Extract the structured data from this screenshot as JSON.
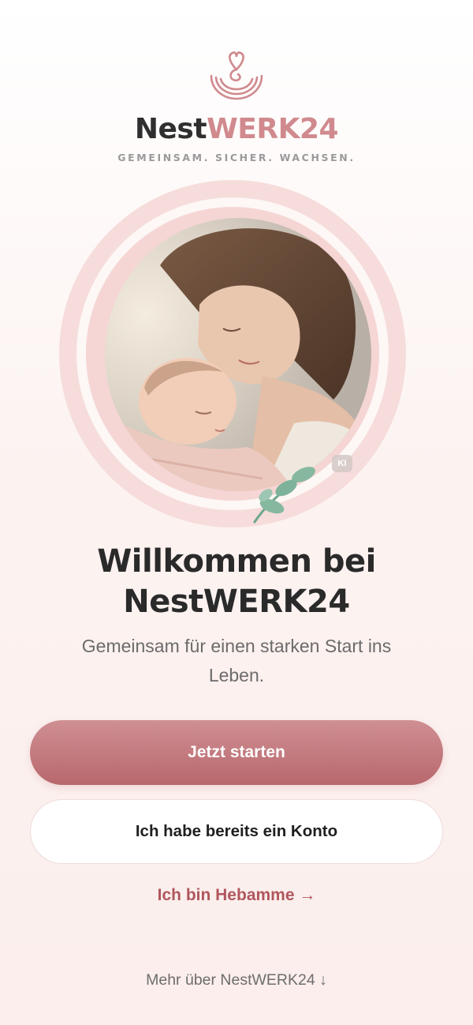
{
  "brand": {
    "name_part1": "Nest",
    "name_part2": "WERK24",
    "tagline": "GEMEINSAM. SICHER. WACHSEN."
  },
  "icons": {
    "logo": "heart-nest-icon",
    "leaf": "leaf-sprig-icon"
  },
  "hero": {
    "image_description": "mother-kissing-newborn-photo",
    "badge": "KI"
  },
  "welcome": {
    "line1": "Willkommen bei",
    "line2": "NestWERK24",
    "subtitle": "Gemeinsam für einen starken Start ins Leben."
  },
  "actions": {
    "start_label": "Jetzt starten",
    "login_label": "Ich habe bereits ein Konto",
    "midwife_label": "Ich bin Hebamme →",
    "more_label": "Mehr über NestWERK24 ↓"
  },
  "colors": {
    "accent": "#c07a7f",
    "accent_text": "#b0575d",
    "brand_pink": "#d08a8e",
    "ring": "#f6dcda",
    "leaf": "#7fb29a"
  }
}
